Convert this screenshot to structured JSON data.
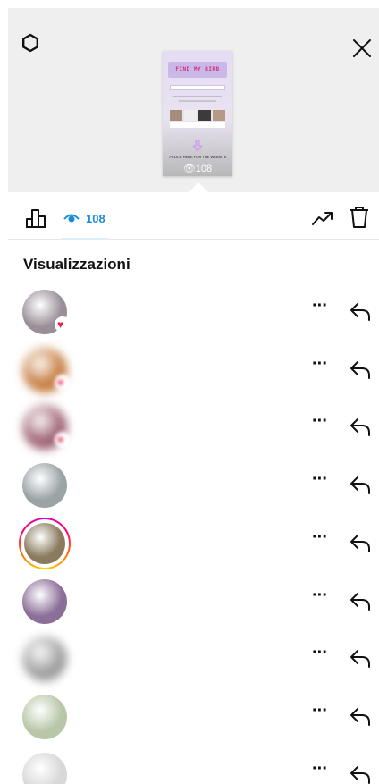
{
  "preview": {
    "banner_text": "FIND MY BIRB",
    "cta_text": "↗CLICK HERE FOR THE WEBSITE",
    "views_count": "108"
  },
  "toolbar": {
    "views_count": "108"
  },
  "section": {
    "title": "Visualizzazioni"
  },
  "viewers": [
    {
      "avatar_color": "#9a8f99",
      "has_heart": true,
      "blurred": false,
      "has_story_ring": false,
      "more": "···"
    },
    {
      "avatar_color": "#c47a3c",
      "has_heart": true,
      "blurred": true,
      "has_story_ring": false,
      "more": "···"
    },
    {
      "avatar_color": "#9b5e70",
      "has_heart": true,
      "blurred": true,
      "has_story_ring": false,
      "more": "···"
    },
    {
      "avatar_color": "#9ba3a6",
      "has_heart": false,
      "blurred": false,
      "has_story_ring": false,
      "more": "···"
    },
    {
      "avatar_color": "#8a7b5f",
      "has_heart": false,
      "blurred": false,
      "has_story_ring": true,
      "more": "···"
    },
    {
      "avatar_color": "#8c6f99",
      "has_heart": false,
      "blurred": false,
      "has_story_ring": false,
      "more": "···"
    },
    {
      "avatar_color": "#9c9c9c",
      "has_heart": false,
      "blurred": true,
      "has_story_ring": false,
      "more": "···"
    },
    {
      "avatar_color": "#b7c7a8",
      "has_heart": false,
      "blurred": false,
      "has_story_ring": false,
      "more": "···"
    },
    {
      "avatar_color": "#d8d8d8",
      "has_heart": false,
      "blurred": false,
      "has_story_ring": false,
      "more": "···"
    }
  ],
  "colors": {
    "accent": "#1a8cd8",
    "heart": "#ed1f4b",
    "header_bg": "#efefef"
  },
  "icons": [
    "settings-icon",
    "close-icon",
    "insights-bars-icon",
    "eye-icon",
    "trend-icon",
    "trash-icon",
    "more-icon",
    "reply-icon",
    "heart-icon"
  ]
}
